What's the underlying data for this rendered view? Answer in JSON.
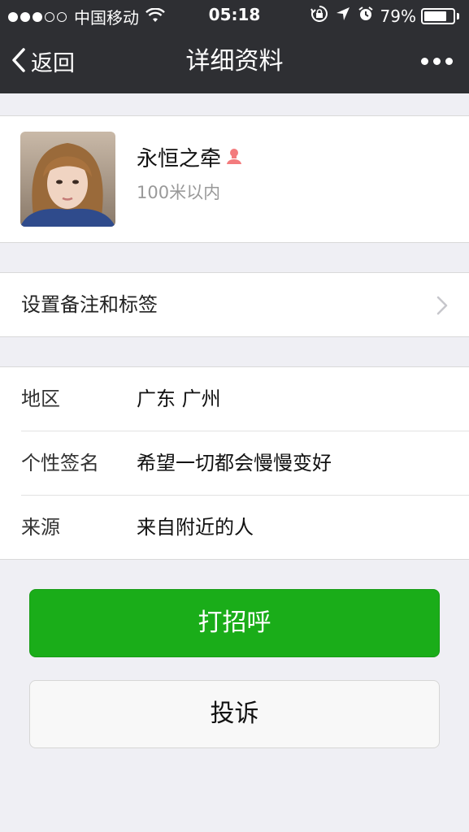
{
  "status_bar": {
    "carrier": "中国移动",
    "time": "05:18",
    "battery_percent": "79%",
    "battery_level": 0.79,
    "signal_bars_filled": 3,
    "signal_bars_total": 5
  },
  "nav": {
    "back_label": "返回",
    "title": "详细资料"
  },
  "profile": {
    "name": "永恒之牵",
    "distance": "100米以内",
    "gender_icon": "female-icon",
    "gender_color": "#f37b7d"
  },
  "remark": {
    "label": "设置备注和标签"
  },
  "info": {
    "rows": [
      {
        "key": "地区",
        "value": "广东 广州"
      },
      {
        "key": "个性签名",
        "value": "希望一切都会慢慢变好"
      },
      {
        "key": "来源",
        "value": "来自附近的人"
      }
    ]
  },
  "buttons": {
    "greet": "打招呼",
    "report": "投诉"
  },
  "colors": {
    "nav_bg": "#2e2f33",
    "page_bg": "#efeff4",
    "primary_green": "#1aad19"
  }
}
